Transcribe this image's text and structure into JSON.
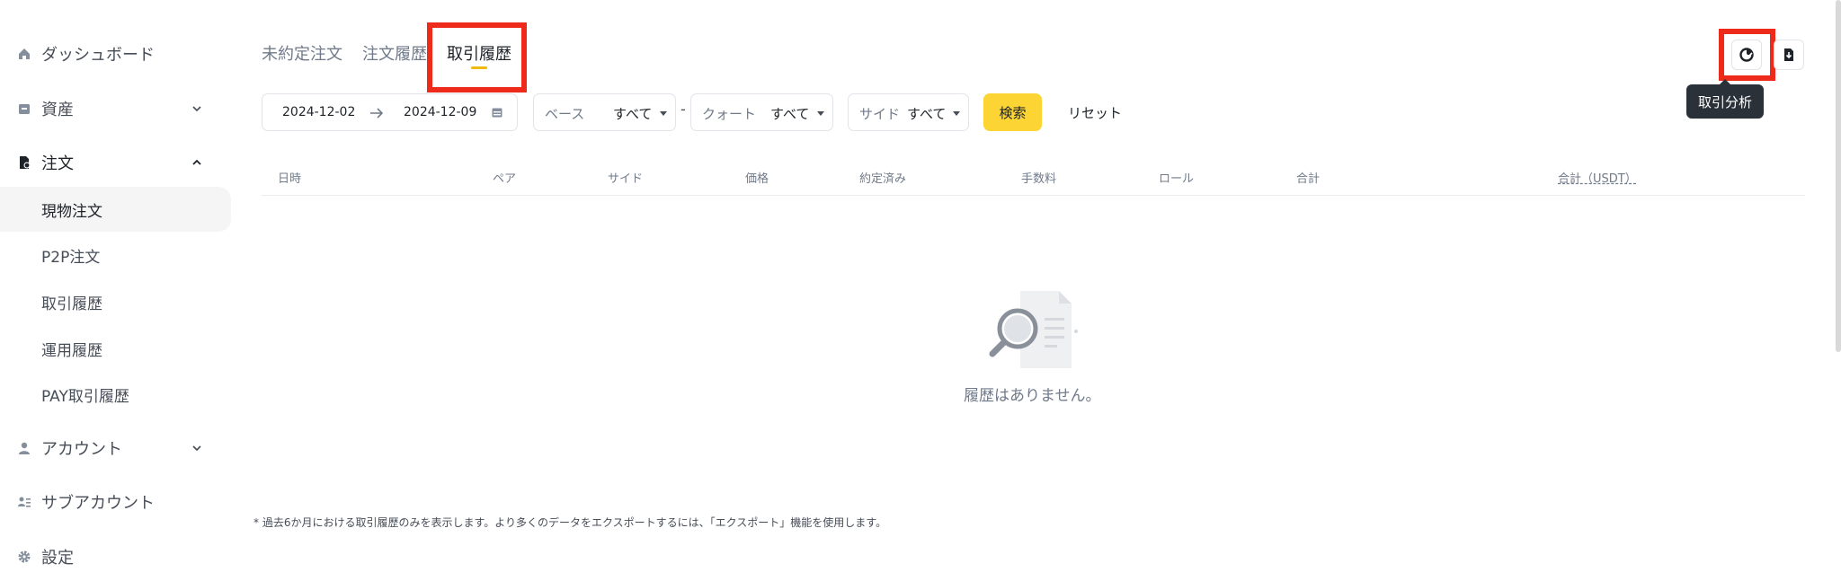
{
  "sidebar": {
    "items": [
      {
        "label": "ダッシュボード",
        "icon": "home-icon"
      },
      {
        "label": "資産",
        "icon": "wallet-icon"
      },
      {
        "label": "注文",
        "icon": "orders-icon"
      },
      {
        "label": "アカウント",
        "icon": "user-icon"
      },
      {
        "label": "サブアカウント",
        "icon": "subaccount-icon"
      },
      {
        "label": "設定",
        "icon": "gear-icon"
      }
    ],
    "sub_items": [
      "現物注文",
      "P2P注文",
      "取引履歴",
      "運用履歴",
      "PAY取引履歴"
    ]
  },
  "tabs": [
    "未約定注文",
    "注文履歴",
    "取引履歴"
  ],
  "filters": {
    "date_start": "2024-12-02",
    "date_end": "2024-12-09",
    "base_label": "ベース",
    "base_value": "すべて",
    "dash": "-",
    "quote_label": "クォート",
    "quote_value": "すべて",
    "side_label": "サイド",
    "side_value": "すべて",
    "search_button": "検索",
    "reset_button": "リセット"
  },
  "table": {
    "headers": [
      "日時",
      "ペア",
      "サイド",
      "価格",
      "約定済み",
      "手数料",
      "ロール",
      "合計",
      "合計（USDT）"
    ]
  },
  "empty_state": "履歴はありません。",
  "footnote": "* 過去6か月における取引履歴のみを表示します。より多くのデータをエクスポートするには、「エクスポート」機能を使用します。",
  "tooltip": "取引分析",
  "colors": {
    "accent": "#fcd535",
    "highlight": "#ee2b1b",
    "tooltip_bg": "#2b3139"
  }
}
